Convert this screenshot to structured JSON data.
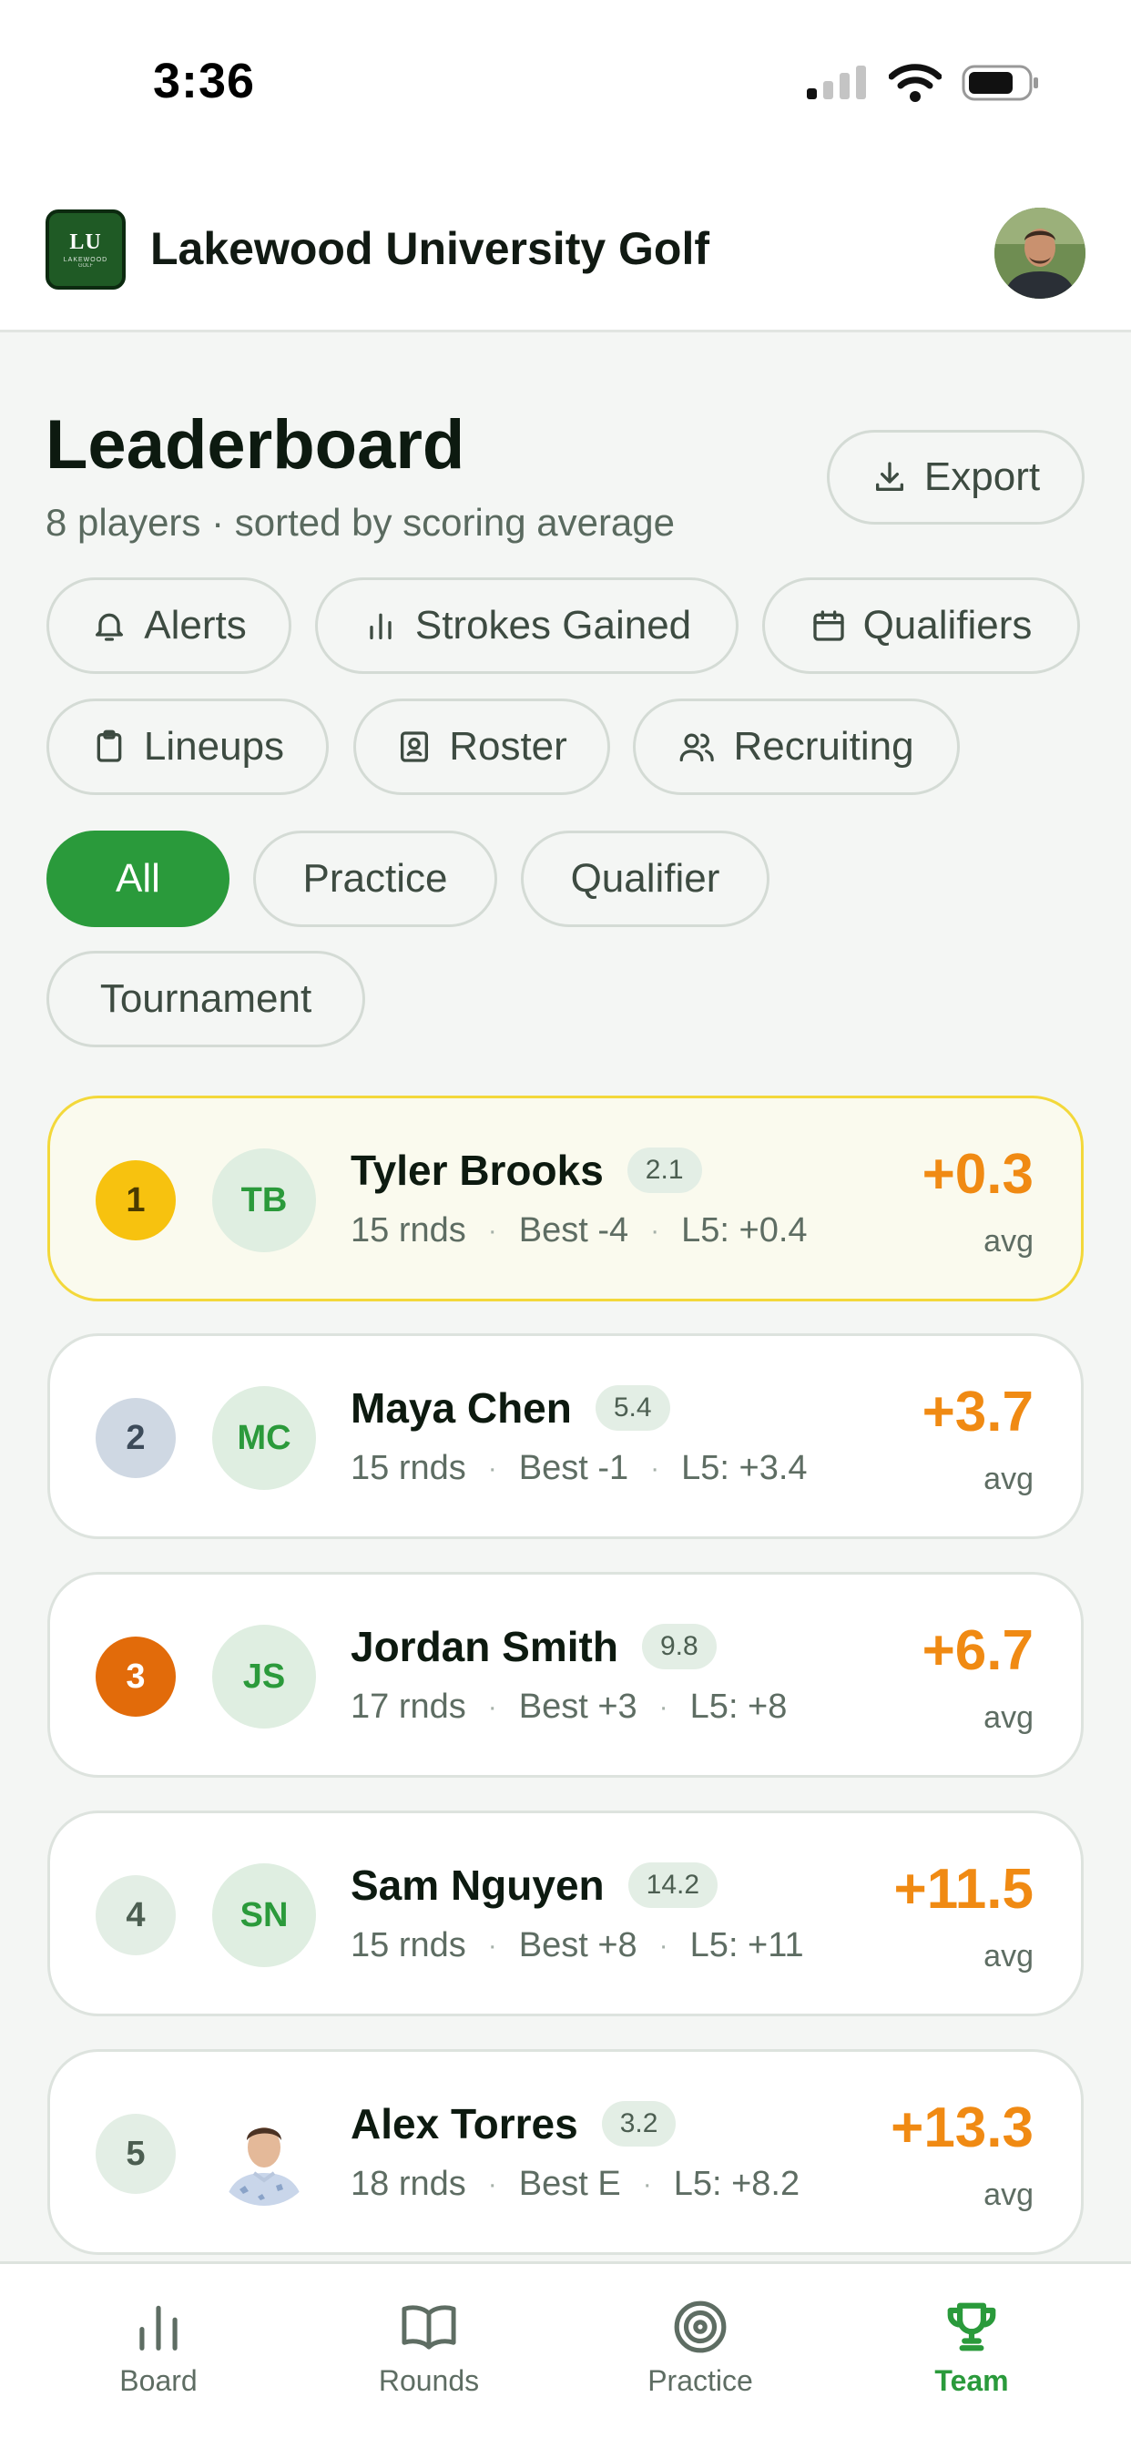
{
  "status_bar": {
    "time": "3:36"
  },
  "header": {
    "logo_text": "LU",
    "logo_sub": "LAKEWOOD",
    "logo_sub2": "GOLF",
    "app_title": "Lakewood University Golf"
  },
  "page": {
    "title": "Leaderboard",
    "subtitle": "8 players · sorted by scoring average",
    "export_label": "Export"
  },
  "shortcuts": [
    {
      "label": "Alerts",
      "icon": "bell-icon"
    },
    {
      "label": "Strokes Gained",
      "icon": "bar-chart-icon"
    },
    {
      "label": "Qualifiers",
      "icon": "calendar-icon"
    },
    {
      "label": "Lineups",
      "icon": "clipboard-icon"
    },
    {
      "label": "Roster",
      "icon": "id-card-icon"
    },
    {
      "label": "Recruiting",
      "icon": "users-icon"
    }
  ],
  "filters": [
    {
      "label": "All",
      "active": true
    },
    {
      "label": "Practice",
      "active": false
    },
    {
      "label": "Qualifier",
      "active": false
    },
    {
      "label": "Tournament",
      "active": false
    }
  ],
  "players": [
    {
      "rank": "1",
      "initials": "TB",
      "name": "Tyler Brooks",
      "handicap": "2.1",
      "rounds": "15 rnds",
      "best": "Best -4",
      "last5": "L5: +0.4",
      "avg": "+0.3",
      "avg_label": "avg",
      "rank_color": "#f7c20f",
      "rank_text_color": "#4a3a00"
    },
    {
      "rank": "2",
      "initials": "MC",
      "name": "Maya Chen",
      "handicap": "5.4",
      "rounds": "15 rnds",
      "best": "Best -1",
      "last5": "L5: +3.4",
      "avg": "+3.7",
      "avg_label": "avg",
      "rank_color": "#cfd8e3",
      "rank_text_color": "#3d4b5a"
    },
    {
      "rank": "3",
      "initials": "JS",
      "name": "Jordan Smith",
      "handicap": "9.8",
      "rounds": "17 rnds",
      "best": "Best +3",
      "last5": "L5: +8",
      "avg": "+6.7",
      "avg_label": "avg",
      "rank_color": "#e26b0a",
      "rank_text_color": "#ffffff"
    },
    {
      "rank": "4",
      "initials": "SN",
      "name": "Sam Nguyen",
      "handicap": "14.2",
      "rounds": "15 rnds",
      "best": "Best +8",
      "last5": "L5: +11",
      "avg": "+11.5",
      "avg_label": "avg",
      "rank_color": "#e3eee5",
      "rank_text_color": "#4c5e51"
    },
    {
      "rank": "5",
      "initials": "",
      "name": "Alex Torres",
      "handicap": "3.2",
      "rounds": "18 rnds",
      "best": "Best E",
      "last5": "L5: +8.2",
      "avg": "+13.3",
      "avg_label": "avg",
      "rank_color": "#e3eee5",
      "rank_text_color": "#4c5e51"
    }
  ],
  "nav": [
    {
      "label": "Board",
      "icon": "bar-chart-icon",
      "active": false
    },
    {
      "label": "Rounds",
      "icon": "book-icon",
      "active": false
    },
    {
      "label": "Practice",
      "icon": "target-icon",
      "active": false
    },
    {
      "label": "Team",
      "icon": "trophy-icon",
      "active": true
    }
  ],
  "colors": {
    "accent": "#2a9a3b",
    "score": "#f08a13",
    "highlight_border": "#f3d83a"
  }
}
